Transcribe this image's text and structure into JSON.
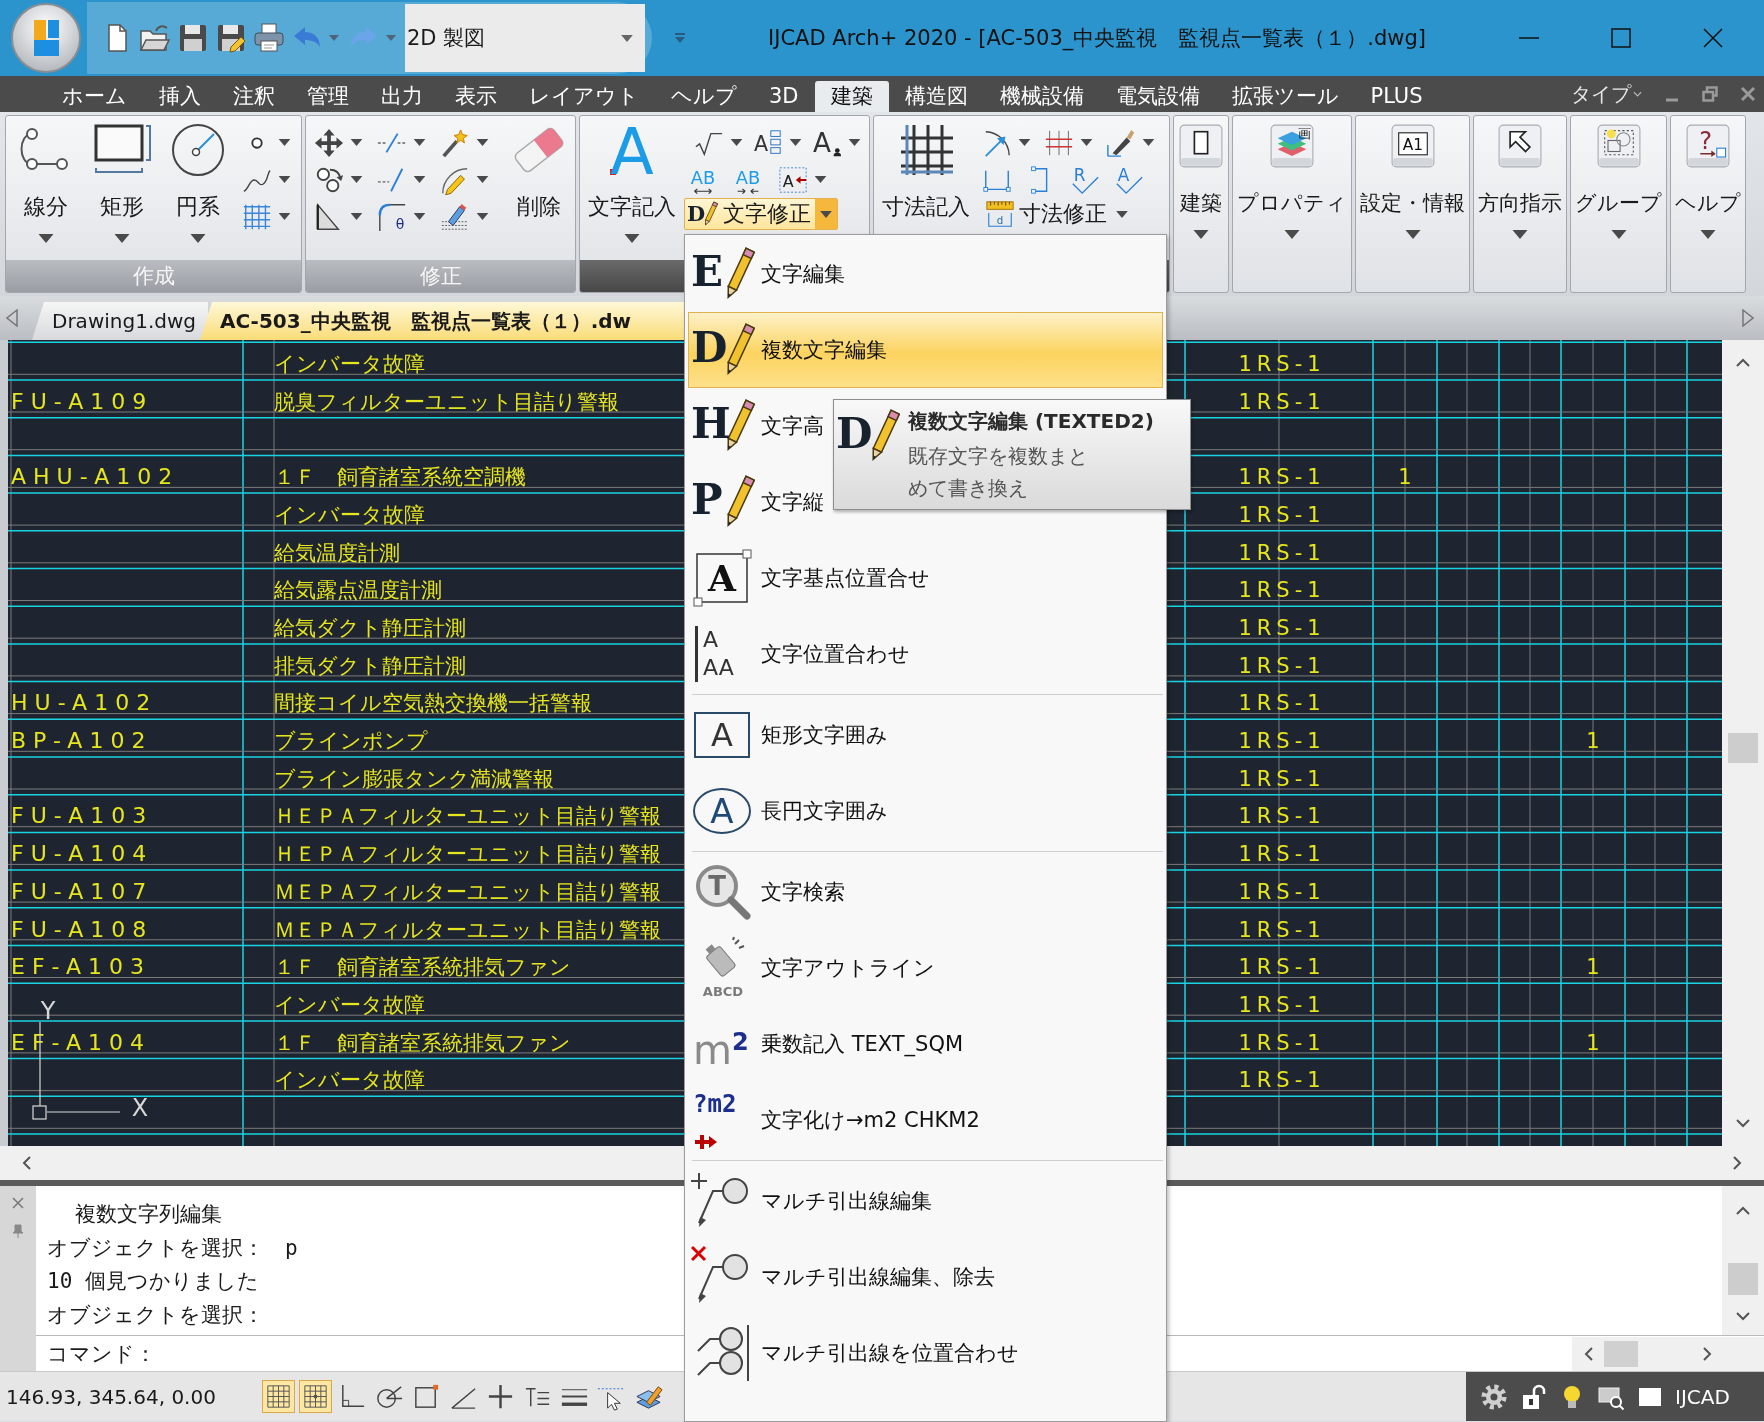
{
  "title_bar": {
    "workspace": "2D 製図",
    "title": "IJCAD Arch+ 2020 - [AC-503_中央監視　監視点一覧表（１）.dwg]"
  },
  "menu_tabs": [
    {
      "label": "ホーム",
      "selected": false
    },
    {
      "label": "挿入",
      "selected": false
    },
    {
      "label": "注釈",
      "selected": false
    },
    {
      "label": "管理",
      "selected": false
    },
    {
      "label": "出力",
      "selected": false
    },
    {
      "label": "表示",
      "selected": false
    },
    {
      "label": "レイアウト",
      "selected": false
    },
    {
      "label": "ヘルプ",
      "selected": false
    },
    {
      "label": "3D",
      "selected": false
    },
    {
      "label": "建築",
      "selected": true
    },
    {
      "label": "構造図",
      "selected": false
    },
    {
      "label": "機械設備",
      "selected": false
    },
    {
      "label": "電気設備",
      "selected": false
    },
    {
      "label": "拡張ツール",
      "selected": false
    },
    {
      "label": "PLUS",
      "selected": false
    }
  ],
  "menu_right": {
    "label": "タイプ"
  },
  "ribbon": {
    "create": {
      "label": "作成",
      "buttons": [
        "線分",
        "矩形",
        "円系"
      ]
    },
    "modify": {
      "label": "修正",
      "button": "削除",
      "glyph": "θ"
    },
    "text": {
      "button": {
        "label": "文字記入",
        "glyph": "A"
      },
      "glyphs": [
        "A",
        "A",
        "AB",
        "AB",
        "A"
      ],
      "split": {
        "glyph": "D",
        "label": "文字修正",
        "expanded": true
      }
    },
    "dimension": {
      "button": "寸法記入",
      "glyphs": [
        "R",
        "A"
      ],
      "split": {
        "glyph": "d",
        "label": "寸法修正",
        "expanded": false
      }
    },
    "tools": [
      {
        "label": "建築"
      },
      {
        "label": "プロパティ",
        "glyph": "画"
      },
      {
        "label": "設定・情報",
        "glyph": "A1"
      },
      {
        "label": "方向指示"
      },
      {
        "label": "グループ"
      },
      {
        "label": "ヘルプ",
        "glyph": "?"
      }
    ]
  },
  "doc_tabs": [
    {
      "label": "Drawing1.dwg",
      "selected": false
    },
    {
      "label": "AC-503_中央監視　監視点一覧表（１）.dw",
      "selected": true
    }
  ],
  "drawing": {
    "rows": [
      {
        "column_2": "インバータ故障",
        "column_3": "1RS-1"
      },
      {
        "column_1": "FU-A109",
        "column_2": "脱臭フィルターユニット目詰り警報",
        "column_3": "1RS-1"
      },
      {},
      {
        "column_1": "AHU-A102",
        "column_2": "１Ｆ　飼育諸室系統空調機",
        "column_3": "1RS-1",
        "column_4": "1"
      },
      {
        "column_2": "インバータ故障",
        "column_3": "1RS-1"
      },
      {
        "column_2": "給気温度計測",
        "column_3": "1RS-1"
      },
      {
        "column_2": "給気露点温度計測",
        "column_3": "1RS-1"
      },
      {
        "column_2": "給気ダクト静圧計測",
        "column_3": "1RS-1"
      },
      {
        "column_2": "排気ダクト静圧計測",
        "column_3": "1RS-1"
      },
      {
        "column_1": "HU-A102",
        "column_2": "間接コイル空気熱交換機一括警報",
        "column_3": "1RS-1"
      },
      {
        "column_1": "BP-A102",
        "column_2": "ブラインポンプ",
        "column_3": "1RS-1",
        "column_7": "1"
      },
      {
        "column_2": "ブライン膨張タンク満減警報",
        "column_3": "1RS-1"
      },
      {
        "column_1": "FU-A103",
        "column_2": "ＨＥＰＡフィルターユニット目詰り警報",
        "column_3": "1RS-1"
      },
      {
        "column_1": "FU-A104",
        "column_2": "ＨＥＰＡフィルターユニット目詰り警報",
        "column_3": "1RS-1"
      },
      {
        "column_1": "FU-A107",
        "column_2": "ＭＥＰＡフィルターユニット目詰り警報",
        "column_3": "1RS-1"
      },
      {
        "column_1": "FU-A108",
        "column_2": "ＭＥＰＡフィルターユニット目詰り警報",
        "column_3": "1RS-1"
      },
      {
        "column_1": "EF-A103",
        "column_2": "１Ｆ　飼育諸室系統排気ファン",
        "column_3": "1RS-1",
        "column_7": "1"
      },
      {
        "column_2": "インバータ故障",
        "column_3": "1RS-1"
      },
      {
        "column_1": "EF-A104",
        "column_2": "１Ｆ　飼育諸室系統排気ファン",
        "column_3": "1RS-1",
        "column_7": "1"
      },
      {
        "column_2": "インバータ故障",
        "column_3": "1RS-1"
      },
      {}
    ],
    "ucs_icon": {
      "x_axis": "X",
      "y_axis": "Y"
    }
  },
  "command": {
    "heading": "複数文字列編集",
    "history": [
      "オブジェクトを選択：　p",
      "10 個見つかりました",
      "オブジェクトを選択："
    ],
    "prompt": "コマンド："
  },
  "status_bar": {
    "coordinates": "146.93, 345.64, 0.00",
    "toggles": [
      {
        "on": true
      },
      {
        "on": true
      },
      {
        "on": false
      },
      {
        "on": false
      },
      {
        "on": false
      },
      {
        "on": false
      },
      {
        "on": false
      },
      {
        "on": false
      },
      {
        "on": false
      },
      {
        "on": false
      },
      {
        "on": false
      }
    ],
    "brand": "IJCAD"
  },
  "dropdown": {
    "groups": [
      {
        "items": [
          {
            "glyph": "E",
            "label": "文字編集",
            "selected": false
          },
          {
            "glyph": "D",
            "label": "複数文字編集",
            "selected": true
          },
          {
            "glyph": "H",
            "label": "文字高",
            "selected": false
          },
          {
            "glyph": "P",
            "label": "文字縦",
            "selected": false
          },
          {
            "glyph": "A",
            "label": "文字基点位置合せ",
            "selected": false
          },
          {
            "glyph": "A AA",
            "label": "文字位置合わせ",
            "selected": false
          }
        ]
      },
      {
        "items": [
          {
            "glyph": "A",
            "label": "矩形文字囲み",
            "selected": false
          },
          {
            "glyph": "A",
            "label": "長円文字囲み",
            "selected": false
          }
        ]
      },
      {
        "items": [
          {
            "glyph": "T",
            "label": "文字検索",
            "selected": false
          },
          {
            "glyph": "ABCD",
            "label": "文字アウトライン",
            "selected": false
          },
          {
            "glyph": "m$^{2}$",
            "label": "乗数記入 TEXT_SQM",
            "selected": false
          },
          {
            "glyph": "?m2",
            "label": "文字化け→m2 CHKM2",
            "selected": false
          }
        ]
      },
      {
        "items": [
          {
            "label": "マルチ引出線編集",
            "selected": false
          },
          {
            "label": "マルチ引出線編集、除去",
            "selected": false
          },
          {
            "label": "マルチ引出線を位置合わせ",
            "selected": false
          }
        ]
      }
    ]
  },
  "tooltip": {
    "glyph": "D",
    "title": "複数文字編集 (TEXTED2)",
    "description": "既存文字を複数まとめて書き換え"
  }
}
